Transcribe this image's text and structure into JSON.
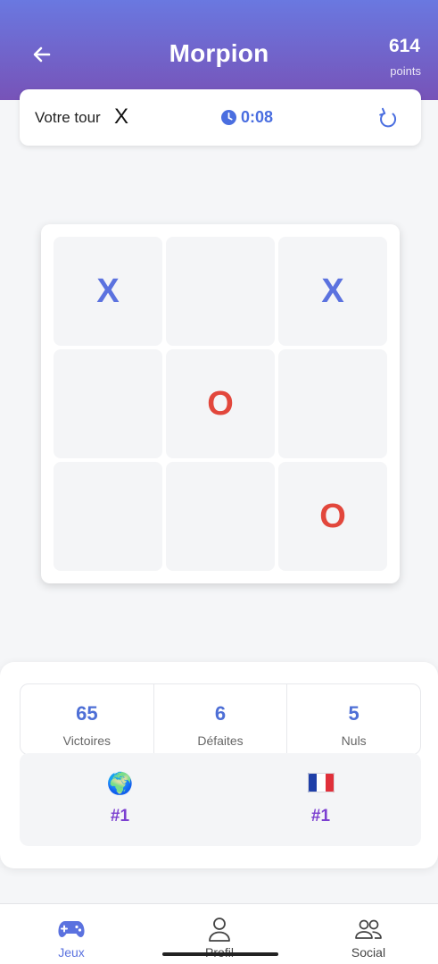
{
  "header": {
    "title": "Morpion",
    "score": "614",
    "score_unit": "points"
  },
  "status": {
    "turn_label": "Votre tour",
    "turn_symbol": "X",
    "timer": "0:08",
    "icons": [
      "back-arrow-icon",
      "clock-icon",
      "refresh-icon"
    ]
  },
  "board": {
    "cells": [
      "X",
      "",
      "X",
      "",
      "O",
      "",
      "",
      "",
      "O"
    ],
    "colors": {
      "x": "#5b72df",
      "o": "#e2473c"
    }
  },
  "stats": [
    {
      "value": "65",
      "label": "Victoires"
    },
    {
      "value": "6",
      "label": "Défaites"
    },
    {
      "value": "5",
      "label": "Nuls"
    }
  ],
  "ranks": [
    {
      "flag": "🌍",
      "icon": "globe-icon",
      "value": "#1"
    },
    {
      "flag": "🇫🇷",
      "icon": "france-flag-icon",
      "value": "#1"
    }
  ],
  "nav": [
    {
      "label": "Jeux",
      "icon": "gamepad-icon",
      "active": true
    },
    {
      "label": "Profil",
      "icon": "user-icon",
      "active": false
    },
    {
      "label": "Social",
      "icon": "users-icon",
      "active": false
    }
  ],
  "theme": {
    "header_gradient": [
      "#6a78e0",
      "#7753b8"
    ],
    "accent": "#4e6fd6",
    "rank_color": "#7b3fd0"
  }
}
